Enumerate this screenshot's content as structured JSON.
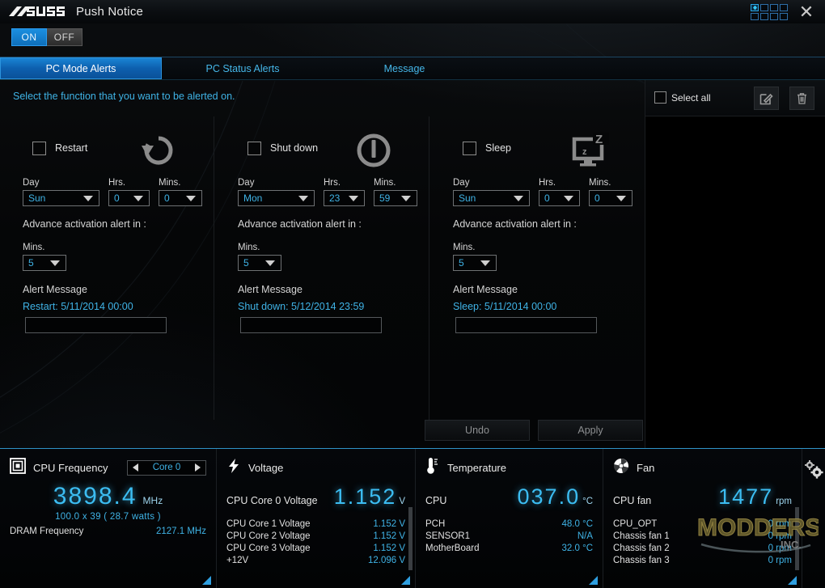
{
  "window": {
    "brand": "ASUS",
    "title": "Push Notice",
    "close_label": "✕"
  },
  "power_toggle": {
    "on_label": "ON",
    "off_label": "OFF",
    "state": "ON"
  },
  "tabs": [
    {
      "label": "PC Mode Alerts",
      "active": true
    },
    {
      "label": "PC Status Alerts",
      "active": false
    },
    {
      "label": "Message",
      "active": false
    }
  ],
  "content": {
    "hint": "Select the function that you want to be alerted on.",
    "field_labels": {
      "day": "Day",
      "hrs": "Hrs.",
      "mins": "Mins."
    },
    "advance_label": "Advance activation alert in :",
    "advance_mins_label": "Mins.",
    "alert_message_label": "Alert Message",
    "columns": [
      {
        "name": "Restart",
        "icon": "restart-icon",
        "checked": false,
        "day": "Sun",
        "hrs": "0",
        "mins": "0",
        "advance_mins": "5",
        "alert_text": "Restart: 5/11/2014 00:00",
        "custom_message": ""
      },
      {
        "name": "Shut down",
        "icon": "power-icon",
        "checked": false,
        "day": "Mon",
        "hrs": "23",
        "mins": "59",
        "advance_mins": "5",
        "alert_text": "Shut down: 5/12/2014 23:59",
        "custom_message": ""
      },
      {
        "name": "Sleep",
        "icon": "sleep-icon",
        "checked": false,
        "day": "Sun",
        "hrs": "0",
        "mins": "0",
        "advance_mins": "5",
        "alert_text": "Sleep: 5/11/2014 00:00",
        "custom_message": ""
      }
    ]
  },
  "actions": {
    "undo_label": "Undo",
    "apply_label": "Apply"
  },
  "right_panel": {
    "select_all_label": "Select all",
    "select_all_checked": false,
    "edit_icon": "edit-icon",
    "delete_icon": "trash-icon"
  },
  "monitor": {
    "cpu_frequency": {
      "title": "CPU Frequency",
      "icon": "cpu-icon",
      "core_selector": "Core 0",
      "value": "3898.4",
      "unit": "MHz",
      "detail": "100.0  x  39  ( 28.7    watts )",
      "rows": [
        {
          "key": "DRAM Frequency",
          "value": "2127.1  MHz"
        }
      ]
    },
    "voltage": {
      "title": "Voltage",
      "icon": "bolt-icon",
      "primary_label": "CPU Core 0 Voltage",
      "primary_value": "1.152",
      "primary_unit": "V",
      "rows": [
        {
          "key": "CPU Core 1 Voltage",
          "value": "1.152  V"
        },
        {
          "key": "CPU Core 2 Voltage",
          "value": "1.152  V"
        },
        {
          "key": "CPU Core 3 Voltage",
          "value": "1.152  V"
        },
        {
          "key": "+12V",
          "value": "12.096  V"
        }
      ]
    },
    "temperature": {
      "title": "Temperature",
      "icon": "thermometer-icon",
      "primary_label": "CPU",
      "primary_value": "037.0",
      "primary_unit": "°C",
      "rows": [
        {
          "key": "PCH",
          "value": "48.0 °C"
        },
        {
          "key": "SENSOR1",
          "value": "N/A"
        },
        {
          "key": "MotherBoard",
          "value": "32.0 °C"
        }
      ]
    },
    "fan": {
      "title": "Fan",
      "icon": "fan-icon",
      "primary_label": "CPU fan",
      "primary_value": "1477",
      "primary_unit": "rpm",
      "rows": [
        {
          "key": "CPU_OPT",
          "value": "0  rpm"
        },
        {
          "key": "Chassis fan 1",
          "value": "0  rpm"
        },
        {
          "key": "Chassis fan 2",
          "value": "0  rpm"
        },
        {
          "key": "Chassis fan 3",
          "value": "0  rpm"
        }
      ]
    },
    "settings_icon": "gears-icon"
  },
  "watermark": {
    "text": "MODDERS",
    "sub": "INC."
  },
  "colors": {
    "accent_blue": "#3fb3e6",
    "tab_active": "#1a84d4",
    "glow_blue": "#3cbdf2",
    "panel_border": "#2f93c7"
  }
}
